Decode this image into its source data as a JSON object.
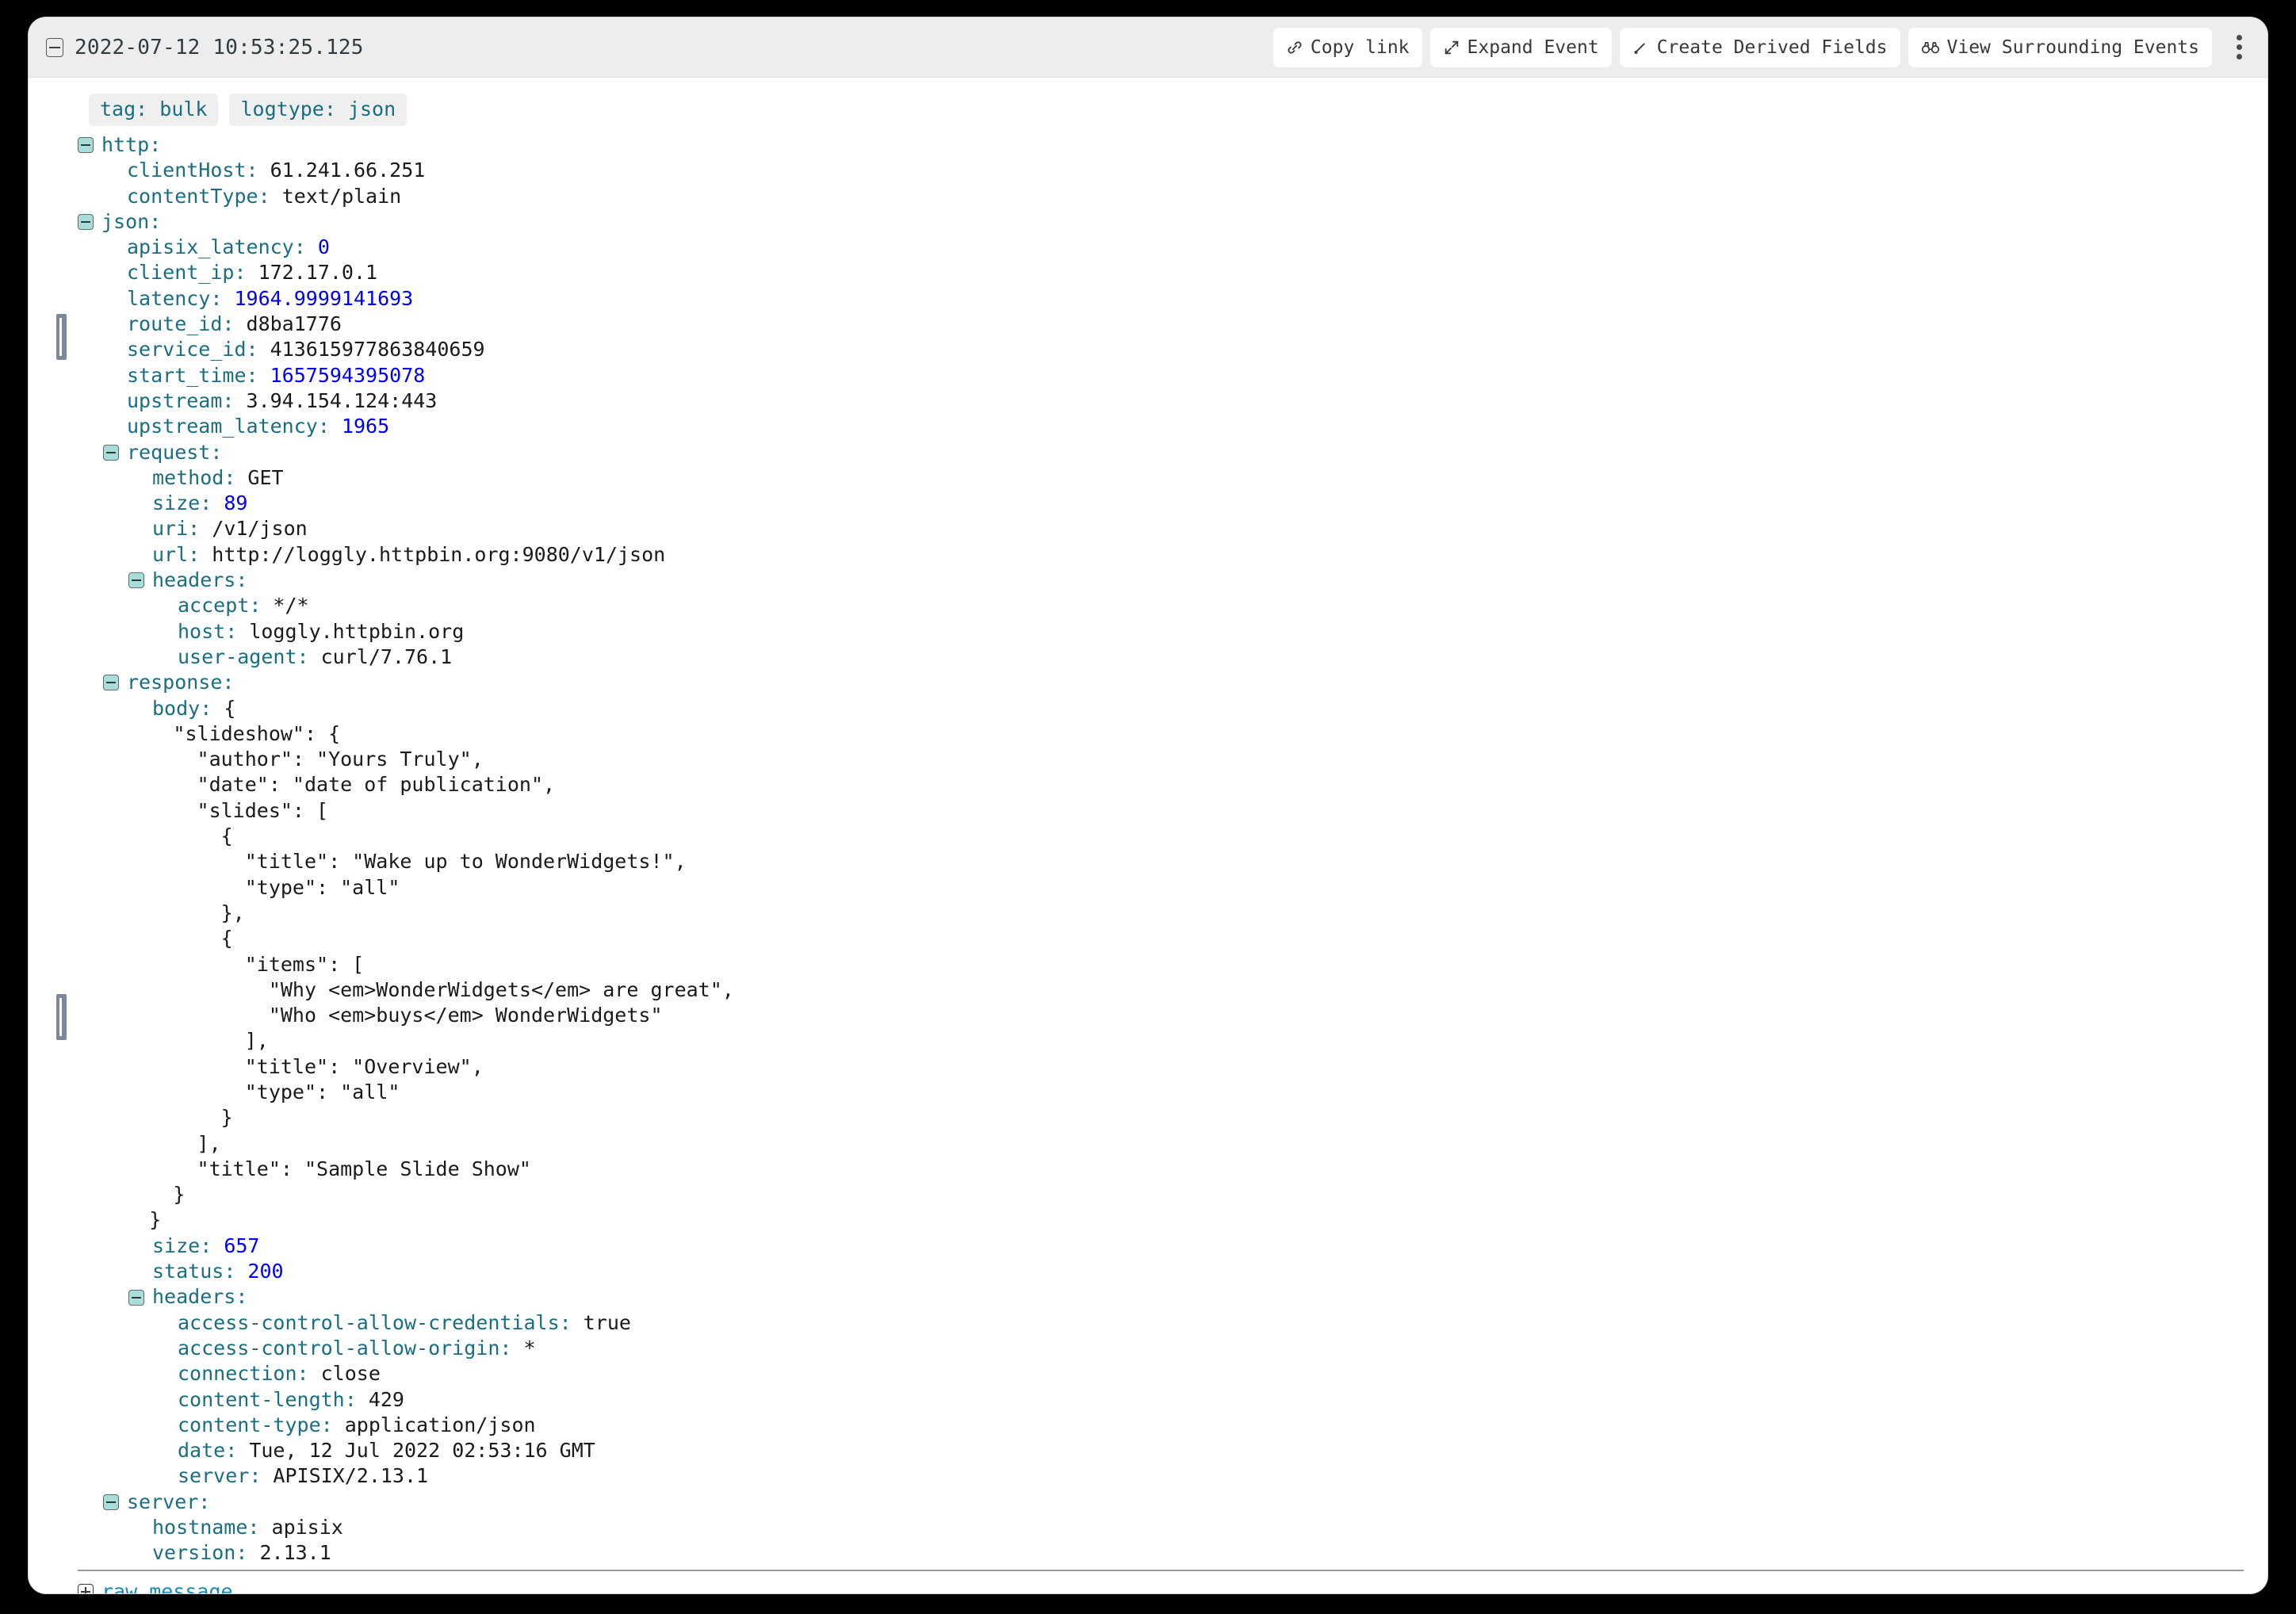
{
  "header": {
    "timestamp": "2022-07-12 10:53:25.125",
    "collapse_icon": "minus-square-icon",
    "actions": [
      {
        "label": "Copy link",
        "icon": "link-icon"
      },
      {
        "label": "Expand Event",
        "icon": "expand-arrows-icon"
      },
      {
        "label": "Create Derived Fields",
        "icon": "derived-fields-icon"
      },
      {
        "label": "View Surrounding Events",
        "icon": "binoculars-icon"
      }
    ],
    "kebab_icon": "more-vertical-icon"
  },
  "tags": [
    {
      "key": "tag",
      "value": "bulk"
    },
    {
      "key": "logtype",
      "value": "json"
    }
  ],
  "fields": [
    {
      "type": "node",
      "indent": 1,
      "key": "http"
    },
    {
      "type": "kv",
      "indent": 2,
      "key": "clientHost",
      "value": "61.241.66.251",
      "vtype": "str"
    },
    {
      "type": "kv",
      "indent": 2,
      "key": "contentType",
      "value": "text/plain",
      "vtype": "str"
    },
    {
      "type": "node",
      "indent": 1,
      "key": "json"
    },
    {
      "type": "kv",
      "indent": 2,
      "key": "apisix_latency",
      "value": "0",
      "vtype": "num"
    },
    {
      "type": "kv",
      "indent": 2,
      "key": "client_ip",
      "value": "172.17.0.1",
      "vtype": "str"
    },
    {
      "type": "kv",
      "indent": 2,
      "key": "latency",
      "value": "1964.9999141693",
      "vtype": "num"
    },
    {
      "type": "kv",
      "indent": 2,
      "key": "route_id",
      "value": "d8ba1776",
      "vtype": "str"
    },
    {
      "type": "kv",
      "indent": 2,
      "key": "service_id",
      "value": "413615977863840659",
      "vtype": "str"
    },
    {
      "type": "kv",
      "indent": 2,
      "key": "start_time",
      "value": "1657594395078",
      "vtype": "num"
    },
    {
      "type": "kv",
      "indent": 2,
      "key": "upstream",
      "value": "3.94.154.124:443",
      "vtype": "str"
    },
    {
      "type": "kv",
      "indent": 2,
      "key": "upstream_latency",
      "value": "1965",
      "vtype": "num"
    },
    {
      "type": "node",
      "indent": 2,
      "key": "request"
    },
    {
      "type": "kv",
      "indent": 3,
      "key": "method",
      "value": "GET",
      "vtype": "str"
    },
    {
      "type": "kv",
      "indent": 3,
      "key": "size",
      "value": "89",
      "vtype": "num"
    },
    {
      "type": "kv",
      "indent": 3,
      "key": "uri",
      "value": "/v1/json",
      "vtype": "str"
    },
    {
      "type": "kv",
      "indent": 3,
      "key": "url",
      "value": "http://loggly.httpbin.org:9080/v1/json",
      "vtype": "str"
    },
    {
      "type": "node",
      "indent": 3,
      "key": "headers"
    },
    {
      "type": "kv",
      "indent": 4,
      "key": "accept",
      "value": "*/*",
      "vtype": "str"
    },
    {
      "type": "kv",
      "indent": 4,
      "key": "host",
      "value": "loggly.httpbin.org",
      "vtype": "str"
    },
    {
      "type": "kv",
      "indent": 4,
      "key": "user-agent",
      "value": "curl/7.76.1",
      "vtype": "str"
    },
    {
      "type": "node",
      "indent": 2,
      "key": "response"
    },
    {
      "type": "raw",
      "indent": 3,
      "key": "body",
      "open": "{"
    },
    {
      "type": "json",
      "text": "        \"slideshow\": {"
    },
    {
      "type": "json",
      "text": "          \"author\": \"Yours Truly\","
    },
    {
      "type": "json",
      "text": "          \"date\": \"date of publication\","
    },
    {
      "type": "json",
      "text": "          \"slides\": ["
    },
    {
      "type": "json",
      "text": "            {"
    },
    {
      "type": "json",
      "text": "              \"title\": \"Wake up to WonderWidgets!\","
    },
    {
      "type": "json",
      "text": "              \"type\": \"all\""
    },
    {
      "type": "json",
      "text": "            },"
    },
    {
      "type": "json",
      "text": "            {"
    },
    {
      "type": "json",
      "text": "              \"items\": ["
    },
    {
      "type": "json",
      "text": "                \"Why <em>WonderWidgets</em> are great\","
    },
    {
      "type": "json",
      "text": "                \"Who <em>buys</em> WonderWidgets\""
    },
    {
      "type": "json",
      "text": "              ],"
    },
    {
      "type": "json",
      "text": "              \"title\": \"Overview\","
    },
    {
      "type": "json",
      "text": "              \"type\": \"all\""
    },
    {
      "type": "json",
      "text": "            }"
    },
    {
      "type": "json",
      "text": "          ],"
    },
    {
      "type": "json",
      "text": "          \"title\": \"Sample Slide Show\""
    },
    {
      "type": "json",
      "text": "        }"
    },
    {
      "type": "json",
      "text": "      }"
    },
    {
      "type": "kv",
      "indent": 3,
      "key": "size",
      "value": "657",
      "vtype": "num"
    },
    {
      "type": "kv",
      "indent": 3,
      "key": "status",
      "value": "200",
      "vtype": "num"
    },
    {
      "type": "node",
      "indent": 3,
      "key": "headers"
    },
    {
      "type": "kv",
      "indent": 4,
      "key": "access-control-allow-credentials",
      "value": "true",
      "vtype": "str"
    },
    {
      "type": "kv",
      "indent": 4,
      "key": "access-control-allow-origin",
      "value": "*",
      "vtype": "str"
    },
    {
      "type": "kv",
      "indent": 4,
      "key": "connection",
      "value": "close",
      "vtype": "str"
    },
    {
      "type": "kv",
      "indent": 4,
      "key": "content-length",
      "value": "429",
      "vtype": "str"
    },
    {
      "type": "kv",
      "indent": 4,
      "key": "content-type",
      "value": "application/json",
      "vtype": "str"
    },
    {
      "type": "kv",
      "indent": 4,
      "key": "date",
      "value": "Tue, 12 Jul 2022 02:53:16 GMT",
      "vtype": "str"
    },
    {
      "type": "kv",
      "indent": 4,
      "key": "server",
      "value": "APISIX/2.13.1",
      "vtype": "str"
    },
    {
      "type": "node",
      "indent": 2,
      "key": "server"
    },
    {
      "type": "kv",
      "indent": 3,
      "key": "hostname",
      "value": "apisix",
      "vtype": "str"
    },
    {
      "type": "kv",
      "indent": 3,
      "key": "version",
      "value": "2.13.1",
      "vtype": "str"
    }
  ],
  "footer": {
    "raw_message_label": "raw_message",
    "expand_icon": "plus-square-icon"
  },
  "colors": {
    "key": "#1a6e80",
    "value_string": "#1a1a1a",
    "value_number": "#0000ee",
    "header_bg": "#ededed",
    "tag_bg": "#efefef",
    "toggle_fill": "#a9ddd9",
    "handle": "#7c879a",
    "raw_message": "#1789b5"
  }
}
